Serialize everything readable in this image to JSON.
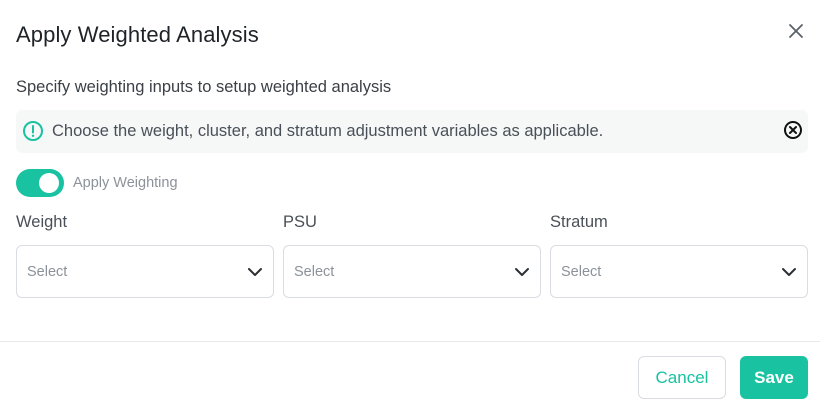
{
  "dialog": {
    "title": "Apply Weighted Analysis",
    "subtitle": "Specify weighting inputs to setup weighted analysis"
  },
  "info_banner": {
    "text": "Choose the weight, cluster, and stratum adjustment variables as applicable.",
    "icon": "info-circle-icon",
    "dismiss_icon": "close-circle-icon"
  },
  "toggle": {
    "label": "Apply Weighting",
    "checked": true
  },
  "fields": [
    {
      "label": "Weight",
      "placeholder": "Select"
    },
    {
      "label": "PSU",
      "placeholder": "Select"
    },
    {
      "label": "Stratum",
      "placeholder": "Select"
    }
  ],
  "footer": {
    "cancel_label": "Cancel",
    "save_label": "Save"
  },
  "colors": {
    "accent": "#19c2a0",
    "muted_text": "#8b929a",
    "border": "#d9dde1"
  }
}
